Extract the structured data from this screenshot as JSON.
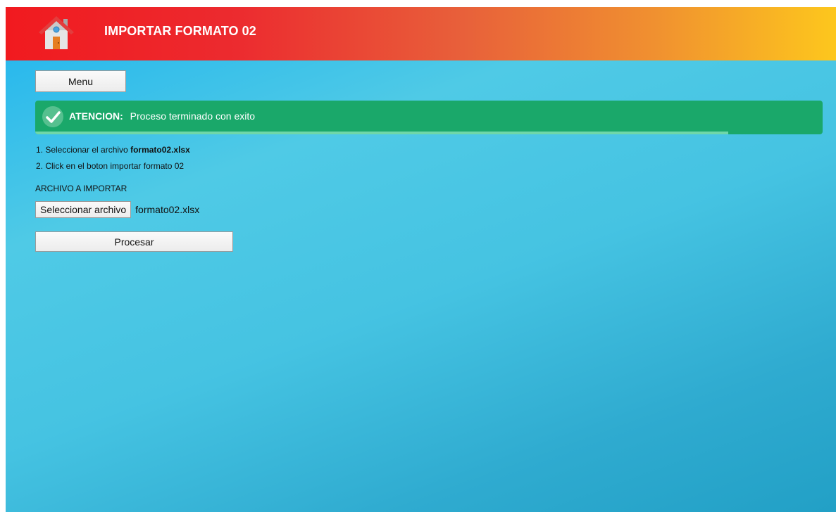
{
  "header": {
    "title": "IMPORTAR FORMATO 02",
    "icon": "home-icon",
    "gradient_start": "#f11a1f",
    "gradient_end": "#fdc71d"
  },
  "toolbar": {
    "menu_label": "Menu"
  },
  "alert": {
    "icon": "checkmark-icon",
    "label": "ATENCION:",
    "message": "Proceso terminado con exito",
    "color": "#1aa86a",
    "progress": 0.88
  },
  "instructions": {
    "step1_prefix": "1. Seleccionar el archivo ",
    "step1_filename": "formato02.xlsx",
    "step2": "2. Click en el boton importar formato 02"
  },
  "file_input": {
    "label": "ARCHIVO A IMPORTAR",
    "button_label": "Seleccionar archivo",
    "selected_file": "formato02.xlsx"
  },
  "actions": {
    "process_label": "Procesar"
  }
}
